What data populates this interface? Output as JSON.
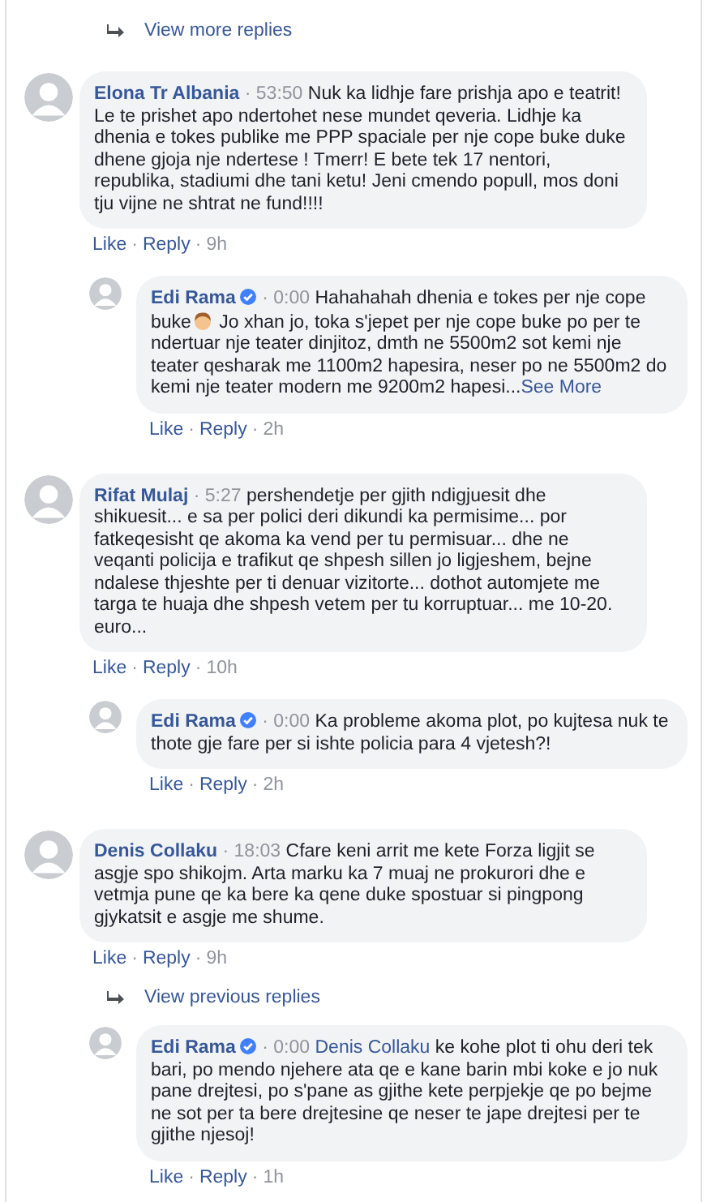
{
  "thread": [
    {
      "kind": "more",
      "label": "View more replies"
    },
    {
      "kind": "comment",
      "name": "Elona Tr Albania",
      "verified": false,
      "meta": "· 53:50",
      "body": [
        {
          "kind": "text",
          "text": "Nuk ka lidhje fare prishja apo e teatrit! Le te prishet apo ndertohet nese mundet qeveria. Lidhje ka dhenia e tokes publike me PPP spaciale per nje cope buke duke dhene gjoja nje ndertese ! Tmerr! E bete tek 17 nentori, republika, stadiumi dhe tani ketu! Jeni cmendo popull, mos doni tju vijne ne shtrat ne fund!!!!"
        }
      ],
      "actions": [
        {
          "kind": "link",
          "text": "Like"
        },
        {
          "kind": "sep",
          "text": "·"
        },
        {
          "kind": "link",
          "text": "Reply"
        },
        {
          "kind": "sep",
          "text": "·"
        },
        {
          "kind": "age",
          "text": "9h"
        }
      ],
      "replies": [
        {
          "kind": "comment",
          "name": "Edi Rama",
          "verified": true,
          "meta": "· 0:00",
          "body": [
            {
              "kind": "text",
              "text": "Hahahahah dhenia e tokes per nje cope buke"
            },
            {
              "kind": "emoji"
            },
            {
              "kind": "text",
              "text": " Jo xhan jo, toka s'jepet per nje cope buke po per te ndertuar nje teater dinjitoz, dmth ne 5500m2 sot kemi nje teater qesharak me 1100m2 hapesira, neser po ne 5500m2 do kemi nje teater modern me 9200m2 hapesi..."
            },
            {
              "kind": "link",
              "text": "See More"
            }
          ],
          "actions": [
            {
              "kind": "link",
              "text": "Like"
            },
            {
              "kind": "sep",
              "text": "·"
            },
            {
              "kind": "link",
              "text": "Reply"
            },
            {
              "kind": "sep",
              "text": "·"
            },
            {
              "kind": "age",
              "text": "2h"
            }
          ]
        }
      ]
    },
    {
      "kind": "comment",
      "name": "Rifat Mulaj",
      "verified": false,
      "meta": "· 5:27",
      "body": [
        {
          "kind": "text",
          "text": "pershendetje per gjith ndigjuesit dhe shikuesit... e sa per polici deri dikundi ka permisime... por fatkeqesisht qe akoma ka vend per tu permisuar... dhe ne veqanti policija e trafikut qe shpesh sillen jo ligjeshem, bejne ndalese thjeshte per ti denuar vizitorte... dothot automjete me targa te huaja dhe shpesh vetem per tu korruptuar... me 10-20. euro..."
        }
      ],
      "actions": [
        {
          "kind": "link",
          "text": "Like"
        },
        {
          "kind": "sep",
          "text": "·"
        },
        {
          "kind": "link",
          "text": "Reply"
        },
        {
          "kind": "sep",
          "text": "·"
        },
        {
          "kind": "age",
          "text": "10h"
        }
      ],
      "replies": [
        {
          "kind": "comment",
          "name": "Edi Rama",
          "verified": true,
          "meta": "· 0:00",
          "body": [
            {
              "kind": "text",
              "text": "Ka probleme akoma plot, po kujtesa nuk te thote gje fare per si ishte policia para 4 vjetesh?!"
            }
          ],
          "actions": [
            {
              "kind": "link",
              "text": "Like"
            },
            {
              "kind": "sep",
              "text": "·"
            },
            {
              "kind": "link",
              "text": "Reply"
            },
            {
              "kind": "sep",
              "text": "·"
            },
            {
              "kind": "age",
              "text": "2h"
            }
          ]
        }
      ]
    },
    {
      "kind": "comment",
      "name": "Denis Collaku",
      "verified": false,
      "meta": "· 18:03",
      "body": [
        {
          "kind": "text",
          "text": "Cfare keni arrit me kete Forza ligjit se asgje spo shikojm. Arta marku ka 7 muaj ne prokurori dhe e vetmja pune qe ka bere ka qene duke spostuar si pingpong gjykatsit e asgje me shume."
        }
      ],
      "actions": [
        {
          "kind": "link",
          "text": "Like"
        },
        {
          "kind": "sep",
          "text": "·"
        },
        {
          "kind": "link",
          "text": "Reply"
        },
        {
          "kind": "sep",
          "text": "·"
        },
        {
          "kind": "age",
          "text": "9h"
        }
      ],
      "replies": [
        {
          "kind": "more",
          "label": "View previous replies"
        },
        {
          "kind": "comment",
          "name": "Edi Rama",
          "verified": true,
          "meta": "· 0:00",
          "body": [
            {
              "kind": "mention",
              "text": "Denis Collaku"
            },
            {
              "kind": "text",
              "text": " ke kohe plot ti ohu deri tek bari, po mendo njehere ata qe e kane barin mbi koke e jo nuk pane drejtesi, po s'pane as gjithe kete perpjekje qe po bejme ne sot per ta bere drejtesine qe neser te jape drejtesi per te gjithe njesoj!"
            }
          ],
          "actions": [
            {
              "kind": "link",
              "text": "Like"
            },
            {
              "kind": "sep",
              "text": "·"
            },
            {
              "kind": "link",
              "text": "Reply"
            },
            {
              "kind": "sep",
              "text": "·"
            },
            {
              "kind": "age",
              "text": "1h"
            }
          ]
        }
      ]
    }
  ]
}
